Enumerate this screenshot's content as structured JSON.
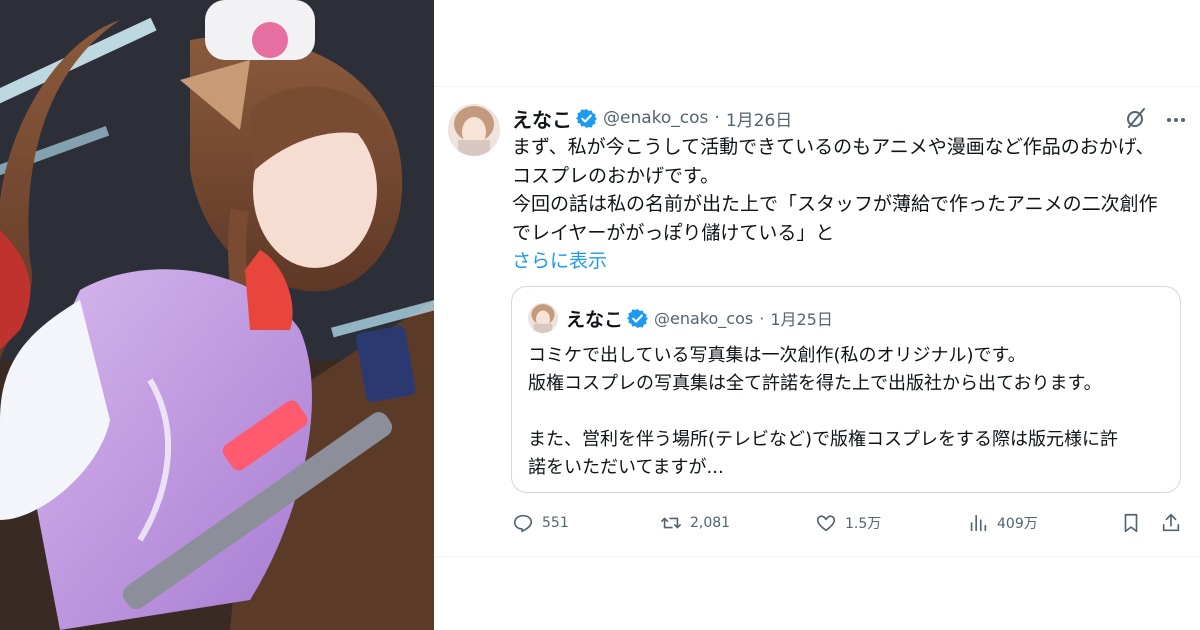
{
  "tweet": {
    "author": {
      "name": "えなこ",
      "handle": "@enako_cos",
      "verified": true
    },
    "separator": "·",
    "date": "1月26日",
    "text_lines": [
      "まず、私が今こうして活動できているのもアニメや漫画など作品のおかげ、",
      "コスプレのおかげです。",
      "今回の話は私の名前が出た上で「スタッフが薄給で作ったアニメの二次創作",
      "でレイヤーががっぽり儲けている」と"
    ],
    "show_more": "さらに表示",
    "quote": {
      "author": {
        "name": "えなこ",
        "handle": "@enako_cos",
        "verified": true
      },
      "separator": "·",
      "date": "1月25日",
      "text_lines": [
        "コミケで出している写真集は一次創作(私のオリジナル)です。",
        "版権コスプレの写真集は全て許諾を得た上で出版社から出ております。",
        "",
        "また、営利を伴う場所(テレビなど)で版権コスプレをする際は版元様に許",
        "諾をいただいてますが..."
      ]
    },
    "stats": {
      "replies": "551",
      "retweets": "2,081",
      "likes": "1.5万",
      "views": "409万"
    }
  },
  "icons": {
    "verified": "verified-badge-icon",
    "grok": "grok-icon",
    "more": "more-icon",
    "reply": "reply-icon",
    "retweet": "retweet-icon",
    "like": "heart-icon",
    "views": "views-icon",
    "bookmark": "bookmark-icon",
    "share": "share-icon"
  },
  "colors": {
    "accent": "#1d9bf0",
    "text": "#0f1419",
    "muted": "#536471",
    "border": "#cfd9de"
  }
}
